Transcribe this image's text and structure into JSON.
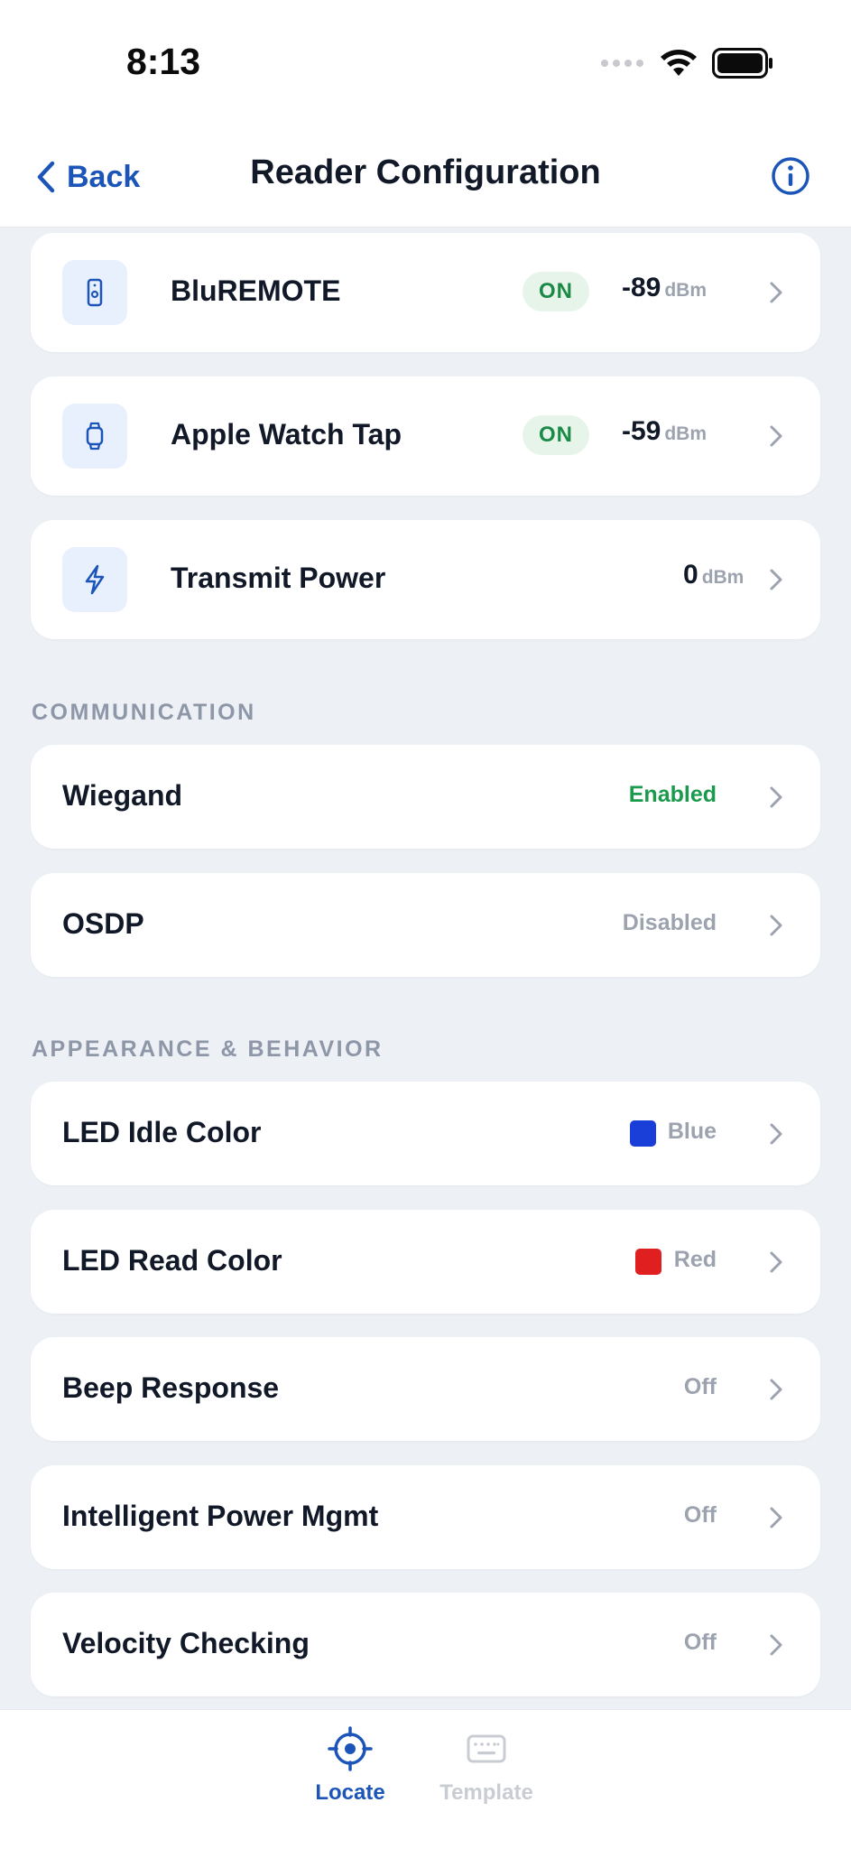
{
  "status_bar": {
    "time": "8:13"
  },
  "nav": {
    "back_label": "Back",
    "title": "Reader Configuration"
  },
  "rows": {
    "bluremote": {
      "label": "BluREMOTE",
      "status": "ON",
      "value": "-89",
      "unit": "dBm",
      "icon": "remote-icon"
    },
    "apple_watch": {
      "label": "Apple Watch Tap",
      "status": "ON",
      "value": "-59",
      "unit": "dBm",
      "icon": "watch-icon"
    },
    "transmit_power": {
      "label": "Transmit Power",
      "value": "0",
      "unit": "dBm",
      "icon": "lightning-icon"
    }
  },
  "sections": {
    "communication": {
      "header": "COMMUNICATION",
      "wiegand": {
        "label": "Wiegand",
        "value": "Enabled"
      },
      "osdp": {
        "label": "OSDP",
        "value": "Disabled"
      }
    },
    "appearance": {
      "header": "APPEARANCE & BEHAVIOR",
      "led_idle": {
        "label": "LED Idle Color",
        "value": "Blue",
        "swatch": "#1a3fd8"
      },
      "led_read": {
        "label": "LED Read Color",
        "value": "Red",
        "swatch": "#e02020"
      },
      "beep": {
        "label": "Beep Response",
        "value": "Off"
      },
      "power_mgmt": {
        "label": "Intelligent Power Mgmt",
        "value": "Off"
      },
      "velocity": {
        "label": "Velocity Checking",
        "value": "Off"
      }
    }
  },
  "tabs": {
    "locate": {
      "label": "Locate",
      "active": true
    },
    "template": {
      "label": "Template",
      "active": false
    }
  },
  "colors": {
    "accent": "#1c55b8",
    "on_green": "#1a8a46",
    "enabled_green": "#1a9a4c"
  }
}
